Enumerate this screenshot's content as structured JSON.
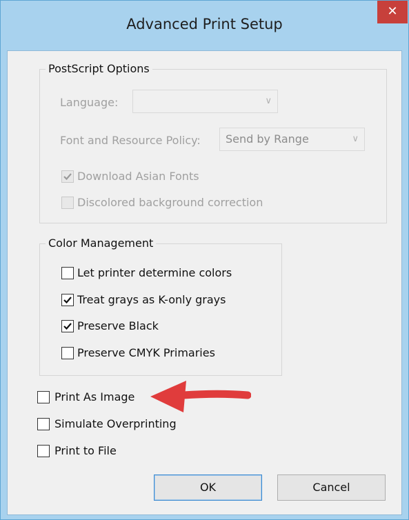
{
  "window": {
    "title": "Advanced Print Setup",
    "close_glyph": "✕"
  },
  "postscript": {
    "title": "PostScript Options",
    "language_label": "Language:",
    "language_value": "",
    "font_policy_label": "Font and Resource Policy:",
    "font_policy_value": "Send by Range",
    "download_asian_fonts": {
      "label": "Download Asian Fonts",
      "checked": true,
      "enabled": false
    },
    "discolored_bg": {
      "label": "Discolored background correction",
      "checked": false,
      "enabled": false
    }
  },
  "color_management": {
    "title": "Color Management",
    "items": [
      {
        "label": "Let printer determine colors",
        "checked": false
      },
      {
        "label": "Treat grays as K-only grays",
        "checked": true
      },
      {
        "label": "Preserve Black",
        "checked": true
      },
      {
        "label": "Preserve CMYK Primaries",
        "checked": false
      }
    ]
  },
  "options": [
    {
      "label": "Print As Image",
      "checked": false
    },
    {
      "label": "Simulate Overprinting",
      "checked": false
    },
    {
      "label": "Print to File",
      "checked": false
    }
  ],
  "buttons": {
    "ok": "OK",
    "cancel": "Cancel"
  },
  "colors": {
    "annotation_arrow": "#e03c3c",
    "close_button": "#c7403b",
    "frame": "#a8d2ee"
  },
  "icons": {
    "close": "close-icon",
    "check": "checkmark-icon",
    "dropdown": "chevron-down-icon",
    "annotation": "red-arrow-icon"
  }
}
